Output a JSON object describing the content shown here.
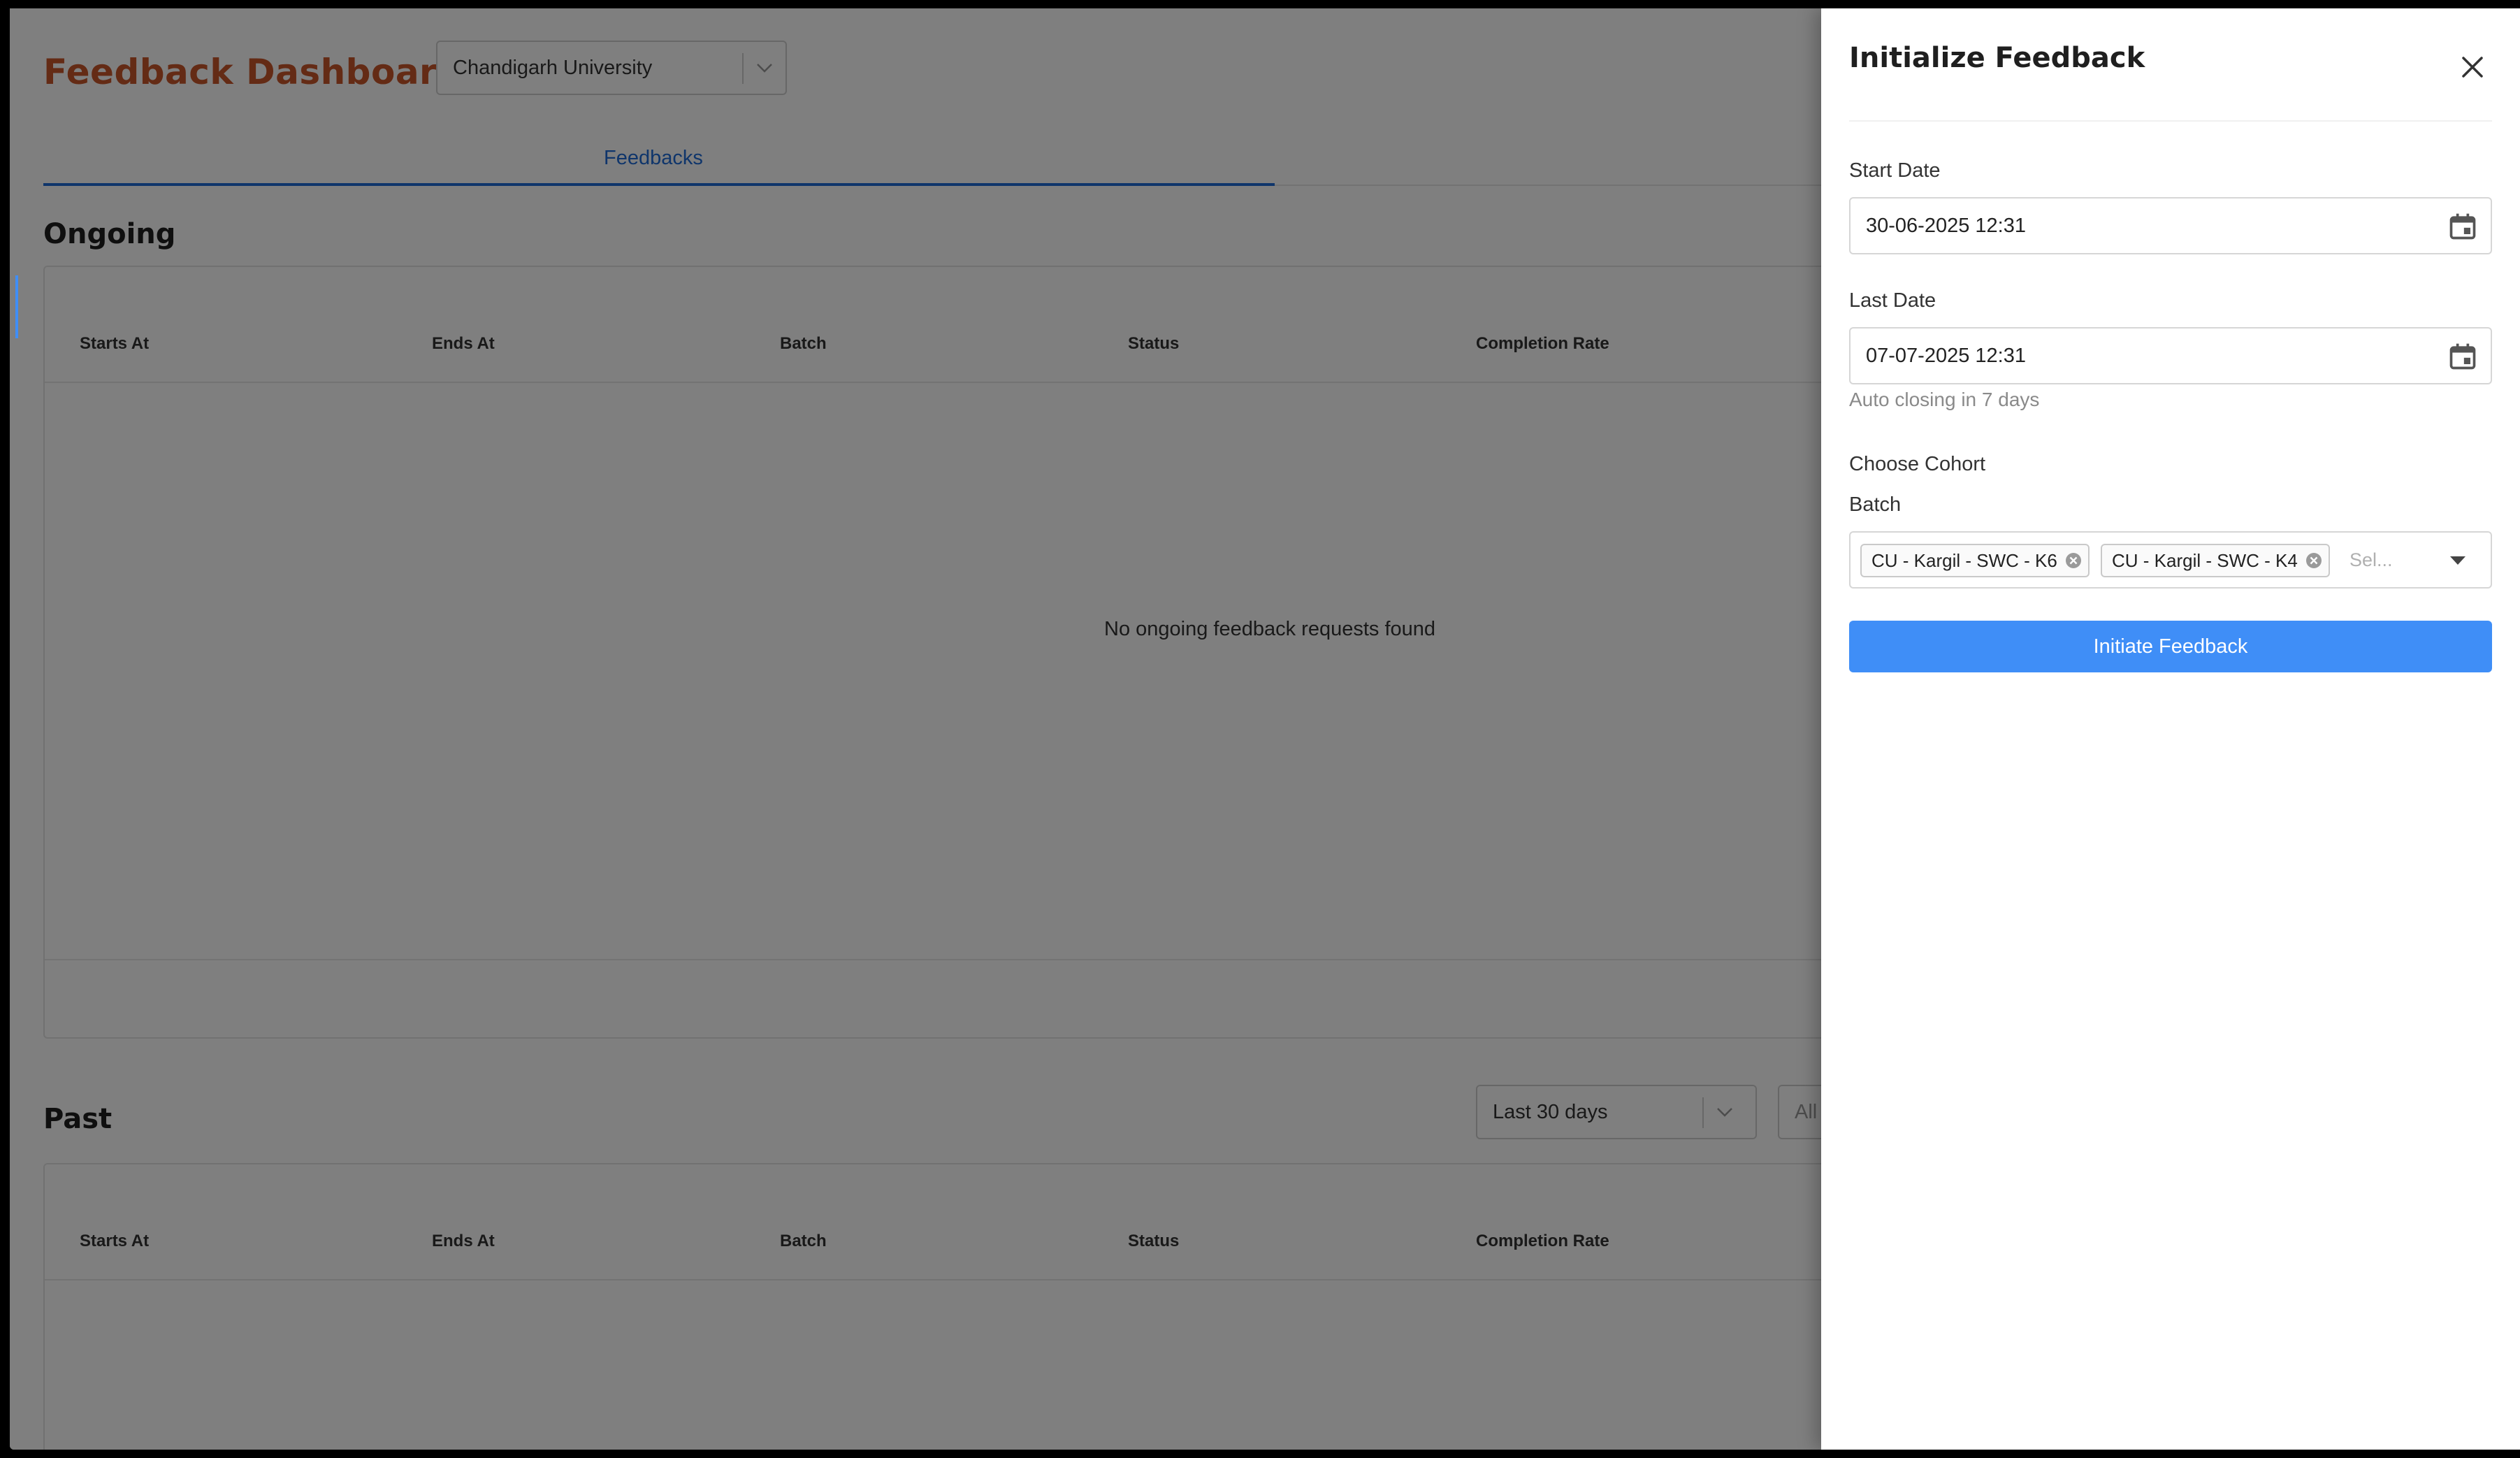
{
  "header": {
    "title": "Feedback Dashboard",
    "university_select": "Chandigarh University"
  },
  "tabs": [
    {
      "label": "Feedbacks",
      "active": true
    }
  ],
  "ongoing": {
    "heading": "Ongoing",
    "columns": [
      "Starts At",
      "Ends At",
      "Batch",
      "Status",
      "Completion Rate"
    ],
    "empty_message": "No ongoing feedback requests found"
  },
  "past": {
    "heading": "Past",
    "range_select": "Last 30 days",
    "second_select": "All",
    "columns": [
      "Starts At",
      "Ends At",
      "Batch",
      "Status",
      "Completion Rate"
    ]
  },
  "drawer": {
    "title": "Initialize Feedback",
    "close_icon": "close-icon",
    "start_date_label": "Start Date",
    "start_date_value": "30-06-2025 12:31",
    "last_date_label": "Last Date",
    "last_date_value": "07-07-2025 12:31",
    "auto_close_hint": "Auto closing in 7 days",
    "cohort_heading": "Choose Cohort",
    "batch_label": "Batch",
    "batch_chips": [
      "CU - Kargil - SWC - K6",
      "CU - Kargil - SWC - K4"
    ],
    "batch_placeholder": "Sel...",
    "submit_label": "Initiate Feedback"
  },
  "colors": {
    "brand_title": "#c8562b",
    "primary": "#3f8ef7",
    "tab_active": "#1e6bd6"
  }
}
